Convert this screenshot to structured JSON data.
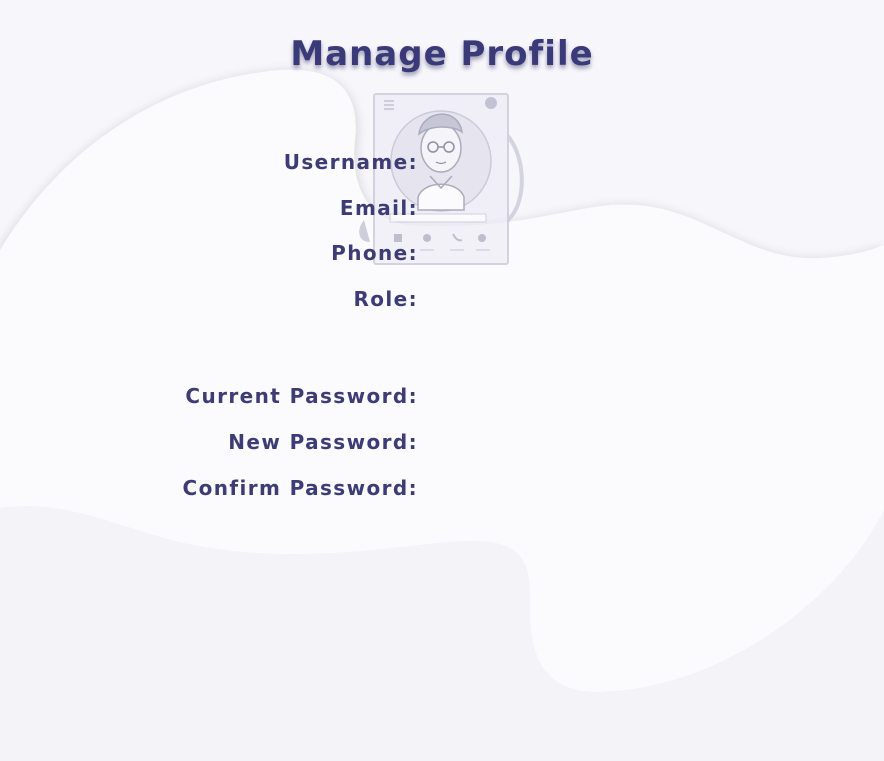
{
  "page": {
    "title": "Manage Profile"
  },
  "profile": {
    "username_label": "Username:",
    "username_value": "",
    "email_label": "Email:",
    "email_value": "",
    "phone_label": "Phone:",
    "phone_value": "",
    "role_label": "Role:",
    "role_value": ""
  },
  "password": {
    "current_label": "Current Password:",
    "current_value": "",
    "new_label": "New Password:",
    "new_value": "",
    "confirm_label": "Confirm Password:",
    "confirm_value": ""
  },
  "icons": {
    "illustration": "profile-card-illustration-icon"
  },
  "colors": {
    "text": "#3d3c74",
    "title": "#3b3a78",
    "background": "#f1f0f6",
    "panel": "#ffffff"
  }
}
